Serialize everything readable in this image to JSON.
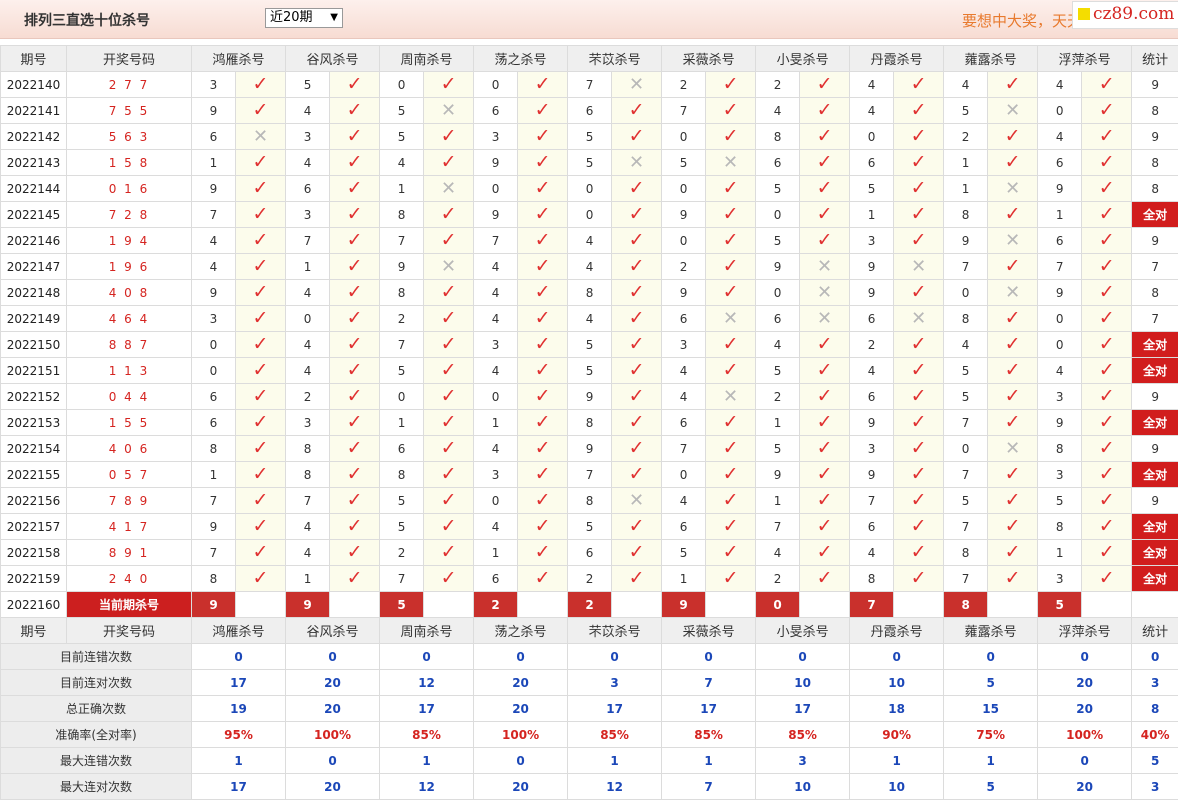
{
  "page": {
    "title": "排列三直选十位杀号",
    "period_select": "近20期",
    "slogan": "要想中大奖，天天彩经网！",
    "logo": "cz89.com"
  },
  "headers": [
    "期号",
    "开奖号码",
    "鸿雁杀号",
    "谷风杀号",
    "周南杀号",
    "荡之杀号",
    "芣苡杀号",
    "采薇杀号",
    "小旻杀号",
    "丹霞杀号",
    "蕹露杀号",
    "浮萍杀号",
    "统计"
  ],
  "rows": [
    {
      "period": "2022140",
      "drawn": "2 7 7",
      "kills": [
        "3",
        "5",
        "0",
        "0",
        "7",
        "2",
        "2",
        "4",
        "4",
        "4"
      ],
      "results": [
        1,
        1,
        1,
        1,
        0,
        1,
        1,
        1,
        1,
        1
      ],
      "stat": "9"
    },
    {
      "period": "2022141",
      "drawn": "7 5 5",
      "kills": [
        "9",
        "4",
        "5",
        "6",
        "6",
        "7",
        "4",
        "4",
        "5",
        "0"
      ],
      "results": [
        1,
        1,
        0,
        1,
        1,
        1,
        1,
        1,
        0,
        1
      ],
      "stat": "8"
    },
    {
      "period": "2022142",
      "drawn": "5 6 3",
      "kills": [
        "6",
        "3",
        "5",
        "3",
        "5",
        "0",
        "8",
        "0",
        "2",
        "4"
      ],
      "results": [
        0,
        1,
        1,
        1,
        1,
        1,
        1,
        1,
        1,
        1
      ],
      "stat": "9"
    },
    {
      "period": "2022143",
      "drawn": "1 5 8",
      "kills": [
        "1",
        "4",
        "4",
        "9",
        "5",
        "5",
        "6",
        "6",
        "1",
        "6"
      ],
      "results": [
        1,
        1,
        1,
        1,
        0,
        0,
        1,
        1,
        1,
        1
      ],
      "stat": "8"
    },
    {
      "period": "2022144",
      "drawn": "0 1 6",
      "kills": [
        "9",
        "6",
        "1",
        "0",
        "0",
        "0",
        "5",
        "5",
        "1",
        "9"
      ],
      "results": [
        1,
        1,
        0,
        1,
        1,
        1,
        1,
        1,
        0,
        1
      ],
      "stat": "8"
    },
    {
      "period": "2022145",
      "drawn": "7 2 8",
      "kills": [
        "7",
        "3",
        "8",
        "9",
        "0",
        "9",
        "0",
        "1",
        "8",
        "1"
      ],
      "results": [
        1,
        1,
        1,
        1,
        1,
        1,
        1,
        1,
        1,
        1
      ],
      "stat": "全对"
    },
    {
      "period": "2022146",
      "drawn": "1 9 4",
      "kills": [
        "4",
        "7",
        "7",
        "7",
        "4",
        "0",
        "5",
        "3",
        "9",
        "6"
      ],
      "results": [
        1,
        1,
        1,
        1,
        1,
        1,
        1,
        1,
        0,
        1
      ],
      "stat": "9"
    },
    {
      "period": "2022147",
      "drawn": "1 9 6",
      "kills": [
        "4",
        "1",
        "9",
        "4",
        "4",
        "2",
        "9",
        "9",
        "7",
        "7"
      ],
      "results": [
        1,
        1,
        0,
        1,
        1,
        1,
        0,
        0,
        1,
        1
      ],
      "stat": "7"
    },
    {
      "period": "2022148",
      "drawn": "4 0 8",
      "kills": [
        "9",
        "4",
        "8",
        "4",
        "8",
        "9",
        "0",
        "9",
        "0",
        "9"
      ],
      "results": [
        1,
        1,
        1,
        1,
        1,
        1,
        0,
        1,
        0,
        1
      ],
      "stat": "8"
    },
    {
      "period": "2022149",
      "drawn": "4 6 4",
      "kills": [
        "3",
        "0",
        "2",
        "4",
        "4",
        "6",
        "6",
        "6",
        "8",
        "0"
      ],
      "results": [
        1,
        1,
        1,
        1,
        1,
        0,
        0,
        0,
        1,
        1
      ],
      "stat": "7"
    },
    {
      "period": "2022150",
      "drawn": "8 8 7",
      "kills": [
        "0",
        "4",
        "7",
        "3",
        "5",
        "3",
        "4",
        "2",
        "4",
        "0"
      ],
      "results": [
        1,
        1,
        1,
        1,
        1,
        1,
        1,
        1,
        1,
        1
      ],
      "stat": "全对"
    },
    {
      "period": "2022151",
      "drawn": "1 1 3",
      "kills": [
        "0",
        "4",
        "5",
        "4",
        "5",
        "4",
        "5",
        "4",
        "5",
        "4"
      ],
      "results": [
        1,
        1,
        1,
        1,
        1,
        1,
        1,
        1,
        1,
        1
      ],
      "stat": "全对"
    },
    {
      "period": "2022152",
      "drawn": "0 4 4",
      "kills": [
        "6",
        "2",
        "0",
        "0",
        "9",
        "4",
        "2",
        "6",
        "5",
        "3"
      ],
      "results": [
        1,
        1,
        1,
        1,
        1,
        0,
        1,
        1,
        1,
        1
      ],
      "stat": "9"
    },
    {
      "period": "2022153",
      "drawn": "1 5 5",
      "kills": [
        "6",
        "3",
        "1",
        "1",
        "8",
        "6",
        "1",
        "9",
        "7",
        "9"
      ],
      "results": [
        1,
        1,
        1,
        1,
        1,
        1,
        1,
        1,
        1,
        1
      ],
      "stat": "全对"
    },
    {
      "period": "2022154",
      "drawn": "4 0 6",
      "kills": [
        "8",
        "8",
        "6",
        "4",
        "9",
        "7",
        "5",
        "3",
        "0",
        "8"
      ],
      "results": [
        1,
        1,
        1,
        1,
        1,
        1,
        1,
        1,
        0,
        1
      ],
      "stat": "9"
    },
    {
      "period": "2022155",
      "drawn": "0 5 7",
      "kills": [
        "1",
        "8",
        "8",
        "3",
        "7",
        "0",
        "9",
        "9",
        "7",
        "3"
      ],
      "results": [
        1,
        1,
        1,
        1,
        1,
        1,
        1,
        1,
        1,
        1
      ],
      "stat": "全对"
    },
    {
      "period": "2022156",
      "drawn": "7 8 9",
      "kills": [
        "7",
        "7",
        "5",
        "0",
        "8",
        "4",
        "1",
        "7",
        "5",
        "5"
      ],
      "results": [
        1,
        1,
        1,
        1,
        0,
        1,
        1,
        1,
        1,
        1
      ],
      "stat": "9"
    },
    {
      "period": "2022157",
      "drawn": "4 1 7",
      "kills": [
        "9",
        "4",
        "5",
        "4",
        "5",
        "6",
        "7",
        "6",
        "7",
        "8"
      ],
      "results": [
        1,
        1,
        1,
        1,
        1,
        1,
        1,
        1,
        1,
        1
      ],
      "stat": "全对"
    },
    {
      "period": "2022158",
      "drawn": "8 9 1",
      "kills": [
        "7",
        "4",
        "2",
        "1",
        "6",
        "5",
        "4",
        "4",
        "8",
        "1"
      ],
      "results": [
        1,
        1,
        1,
        1,
        1,
        1,
        1,
        1,
        1,
        1
      ],
      "stat": "全对"
    },
    {
      "period": "2022159",
      "drawn": "2 4 0",
      "kills": [
        "8",
        "1",
        "7",
        "6",
        "2",
        "1",
        "2",
        "8",
        "7",
        "3"
      ],
      "results": [
        1,
        1,
        1,
        1,
        1,
        1,
        1,
        1,
        1,
        1
      ],
      "stat": "全对"
    }
  ],
  "current": {
    "period": "2022160",
    "label": "当前期杀号",
    "kills": [
      "9",
      "9",
      "5",
      "2",
      "2",
      "9",
      "0",
      "7",
      "8",
      "5"
    ]
  },
  "summary": [
    {
      "label": "目前连错次数",
      "values": [
        "0",
        "0",
        "0",
        "0",
        "0",
        "0",
        "0",
        "0",
        "0",
        "0"
      ],
      "stat": "0",
      "kind": "sv"
    },
    {
      "label": "目前连对次数",
      "values": [
        "17",
        "20",
        "12",
        "20",
        "3",
        "7",
        "10",
        "10",
        "5",
        "20"
      ],
      "stat": "3",
      "kind": "sv"
    },
    {
      "label": "总正确次数",
      "values": [
        "19",
        "20",
        "17",
        "20",
        "17",
        "17",
        "17",
        "18",
        "15",
        "20"
      ],
      "stat": "8",
      "kind": "sv"
    },
    {
      "label": "准确率(全对率)",
      "values": [
        "95%",
        "100%",
        "85%",
        "100%",
        "85%",
        "85%",
        "85%",
        "90%",
        "75%",
        "100%"
      ],
      "stat": "40%",
      "kind": "acc"
    },
    {
      "label": "最大连错次数",
      "values": [
        "1",
        "0",
        "1",
        "0",
        "1",
        "1",
        "3",
        "1",
        "1",
        "0"
      ],
      "stat": "5",
      "kind": "sv"
    },
    {
      "label": "最大连对次数",
      "values": [
        "17",
        "20",
        "12",
        "20",
        "12",
        "7",
        "10",
        "10",
        "5",
        "20"
      ],
      "stat": "3",
      "kind": "sv"
    }
  ],
  "icons": {
    "correct": "check-icon",
    "wrong": "cross-icon"
  },
  "colors": {
    "accent": "#d52420",
    "full_correct_bg": "#d11d1d",
    "summary_value": "#1b47b8"
  }
}
